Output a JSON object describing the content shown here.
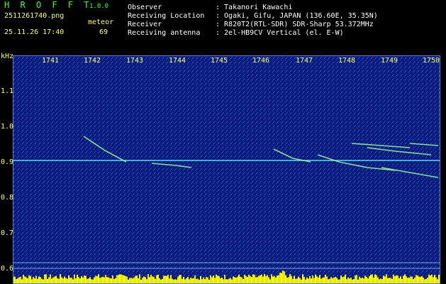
{
  "header": {
    "brand": "H R O F F T",
    "version": "1.0.0",
    "filename": "2511261740.png",
    "datetime": "25.11.26 17:40",
    "meteor_label": "meteor",
    "meteor_count": "69"
  },
  "info": [
    {
      "key": "Observer",
      "value": ": Takanori Kawachi"
    },
    {
      "key": "Receiving Location",
      "value": ": Ogaki, Gifu, JAPAN (136.60E, 35.35N)"
    },
    {
      "key": "Receiver",
      "value": ": R820T2(RTL-SDR) SDR-Sharp 53.372MHz"
    },
    {
      "key": "Receiving antenna",
      "value": ": 2el-HB9CV Vertical (el. E-W)"
    }
  ],
  "axes": {
    "y_unit": "kHz",
    "x_ticks": [
      "1741",
      "1742",
      "1743",
      "1744",
      "1745",
      "1746",
      "1747",
      "1748",
      "1749",
      "1750"
    ],
    "y_ticks": [
      "1.1",
      "1.0",
      "0.9",
      "0.8",
      "0.7",
      "0.6"
    ]
  },
  "colors": {
    "background": "#000000",
    "spectrum_bg": "#0a1a7a",
    "text_yellow": "#ffff66",
    "brand_green": "#33ff33",
    "carrier_line": "#66ffff",
    "signal_level": "#ffff00"
  }
}
